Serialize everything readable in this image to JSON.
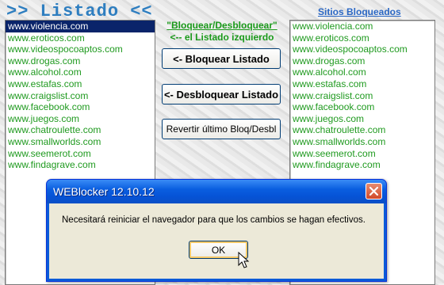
{
  "header": {
    "title": ">> Listado <<",
    "sites_header": "Sitios Bloqueados",
    "mid_line1": "\"Bloquear/Desbloquear\"",
    "mid_line2": "<-- el Listado izquierdo"
  },
  "left_list": {
    "items": [
      "www.violencia.com",
      "www.eroticos.com",
      "www.videospocoaptos.com",
      "www.drogas.com",
      "www.alcohol.com",
      "www.estafas.com",
      "www.craigslist.com",
      "www.facebook.com",
      "www.juegos.com",
      "www.chatroulette.com",
      "www.smallworlds.com",
      "www.seemerot.com",
      "www.findagrave.com"
    ],
    "selected_index": 0
  },
  "right_list": {
    "items": [
      "www.violencia.com",
      "www.eroticos.com",
      "www.videospocoaptos.com",
      "www.drogas.com",
      "www.alcohol.com",
      "www.estafas.com",
      "www.craigslist.com",
      "www.facebook.com",
      "www.juegos.com",
      "www.chatroulette.com",
      "www.smallworlds.com",
      "www.seemerot.com",
      "www.findagrave.com"
    ]
  },
  "buttons": {
    "block": "<-     Bloquear Listado",
    "unblock": "<- Desbloquear Listado",
    "revert": "Revertir último Bloq/Desbl"
  },
  "dialog": {
    "title": "WEBlocker 12.10.12",
    "message": "Necesitará reiniciar el navegador para que los cambios se hagan efectivos.",
    "ok_label": "OK",
    "close_icon": "close-icon"
  },
  "colors": {
    "list_text": "#1f9a1f",
    "title_blue": "#2e7ec0",
    "selection": "#0a246a",
    "xp_titlebar": "#0a5ee0"
  }
}
